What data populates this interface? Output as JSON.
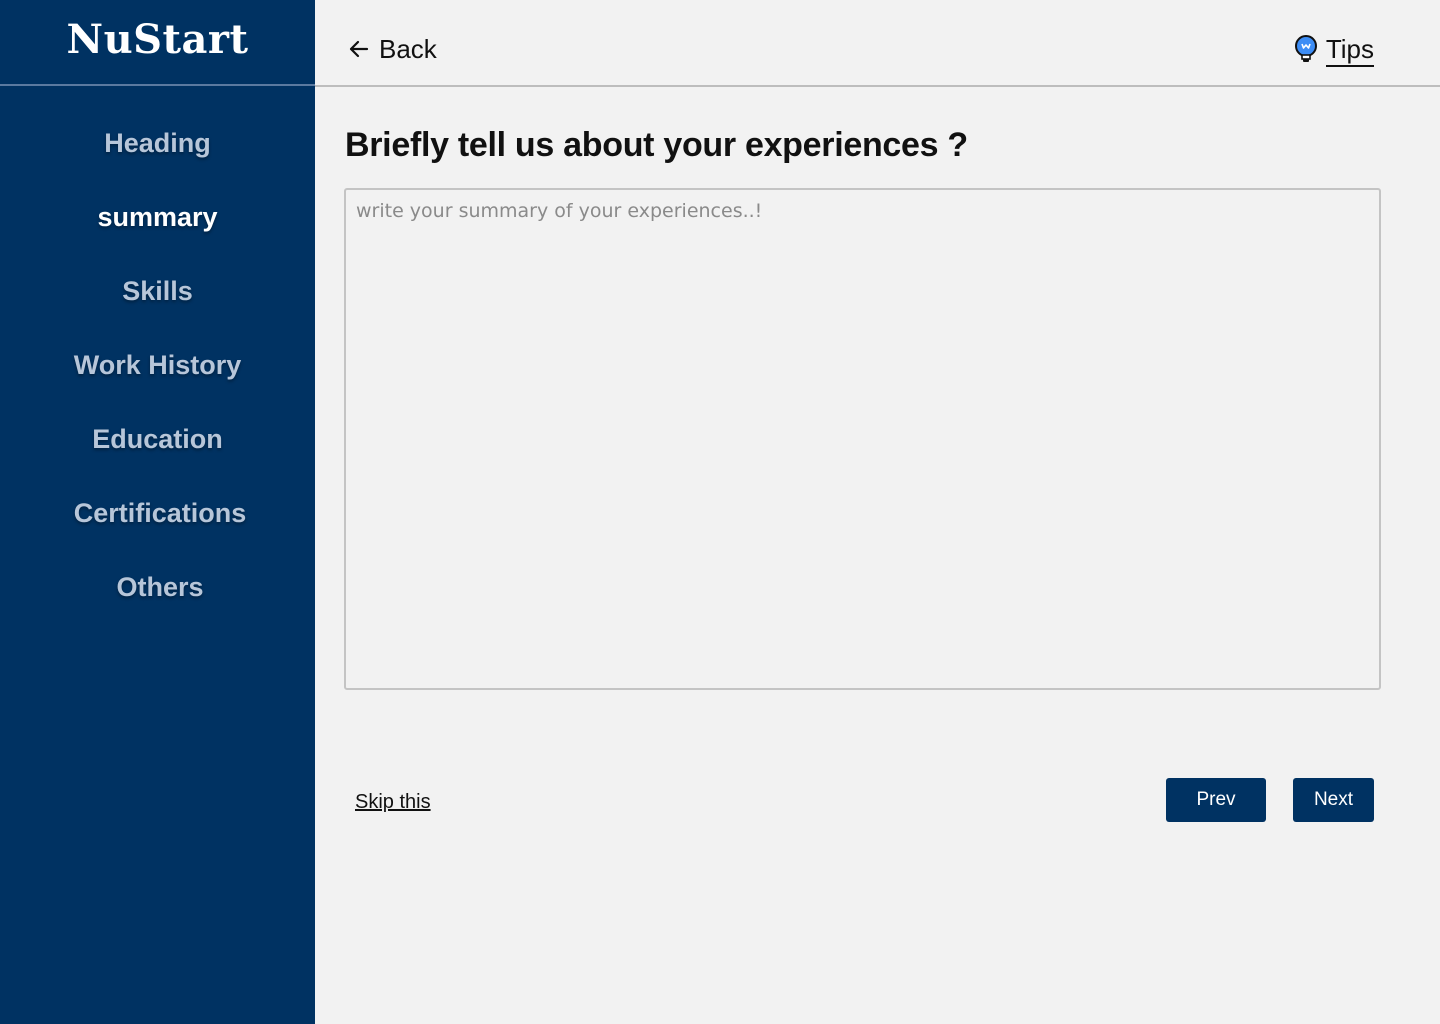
{
  "brand": {
    "name": "NuStart"
  },
  "sidebar": {
    "items": [
      {
        "label": "Heading",
        "active": false
      },
      {
        "label": "summary",
        "active": true
      },
      {
        "label": "Skills",
        "active": false
      },
      {
        "label": "Work History",
        "active": false
      },
      {
        "label": "Education",
        "active": false
      },
      {
        "label": "Certifications",
        "active": false
      },
      {
        "label": "Others",
        "active": false
      }
    ]
  },
  "topbar": {
    "back_label": "Back",
    "back_icon": "arrow-left-icon",
    "tips_label": "Tips",
    "tips_icon": "lightbulb-icon"
  },
  "main": {
    "title": "Briefly tell us about your experiences ?",
    "summary_placeholder": "write your summary of your experiences..!",
    "summary_value": "",
    "skip_label": "Skip this",
    "prev_label": "Prev",
    "next_label": "Next"
  },
  "colors": {
    "sidebar_bg": "#003262",
    "page_bg": "#f2f2f2",
    "button_bg": "#003262",
    "nav_inactive": "#b7c6d9",
    "nav_active": "#ffffff",
    "tips_icon_fill": "#3d8df5"
  }
}
